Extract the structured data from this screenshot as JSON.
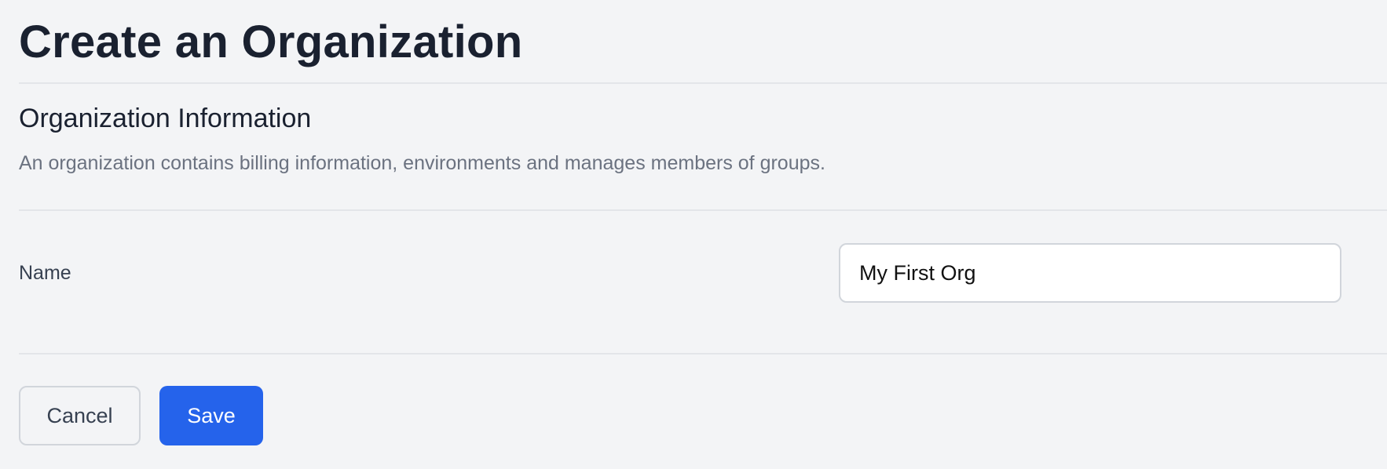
{
  "page": {
    "title": "Create an Organization"
  },
  "section": {
    "title": "Organization Information",
    "description": "An organization contains billing information, environments and manages members of groups."
  },
  "form": {
    "name_label": "Name",
    "name_value": "My First Org"
  },
  "actions": {
    "cancel_label": "Cancel",
    "save_label": "Save"
  },
  "colors": {
    "background": "#f3f4f6",
    "primary": "#2563eb",
    "heading": "#1a2130",
    "muted_text": "#6b7280"
  }
}
